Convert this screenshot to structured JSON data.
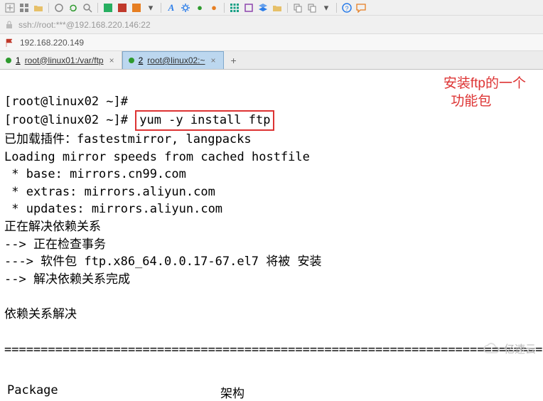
{
  "toolbar": {
    "icons": [
      "plus",
      "grid",
      "folder",
      "sep",
      "circle",
      "refresh",
      "search",
      "sep",
      "app-green",
      "app-red",
      "app-orange",
      "dropdown",
      "sep",
      "letter-a",
      "gear-blue",
      "dot-green",
      "dot-orange",
      "sep",
      "nine-grid",
      "box",
      "layers",
      "folder2",
      "sep",
      "copy",
      "pin",
      "sep",
      "help",
      "chat"
    ]
  },
  "address_bar": {
    "text": "ssh://root:***@192.168.220.146:22"
  },
  "bookmark": {
    "ip": "192.168.220.149"
  },
  "tabs": [
    {
      "num": "1",
      "label": "root@linux01:/var/ftp",
      "active": false
    },
    {
      "num": "2",
      "label": "root@linux02:~",
      "active": true
    }
  ],
  "terminal": {
    "line1_prompt": "[root@linux02 ~]#",
    "line2_prompt": "[root@linux02 ~]# ",
    "line2_cmd": "yum -y install ftp",
    "line3": "已加载插件：fastestmirror, langpacks",
    "line4": "Loading mirror speeds from cached hostfile",
    "line5": " * base: mirrors.cn99.com",
    "line6": " * extras: mirrors.aliyun.com",
    "line7": " * updates: mirrors.aliyun.com",
    "line8": "正在解决依赖关系",
    "line9": "--> 正在检查事务",
    "line10": "---> 软件包 ftp.x86_64.0.0.17-67.el7 将被 安装",
    "line11": "--> 解决依赖关系完成",
    "line12": "",
    "line13": "依赖关系解决",
    "line14": "",
    "divider": "===================================================================================",
    "col1": "Package",
    "col2": "架构"
  },
  "annotation": {
    "l1": "安装ftp的一个",
    "l2": "  功能包"
  },
  "watermark": "亿速云"
}
